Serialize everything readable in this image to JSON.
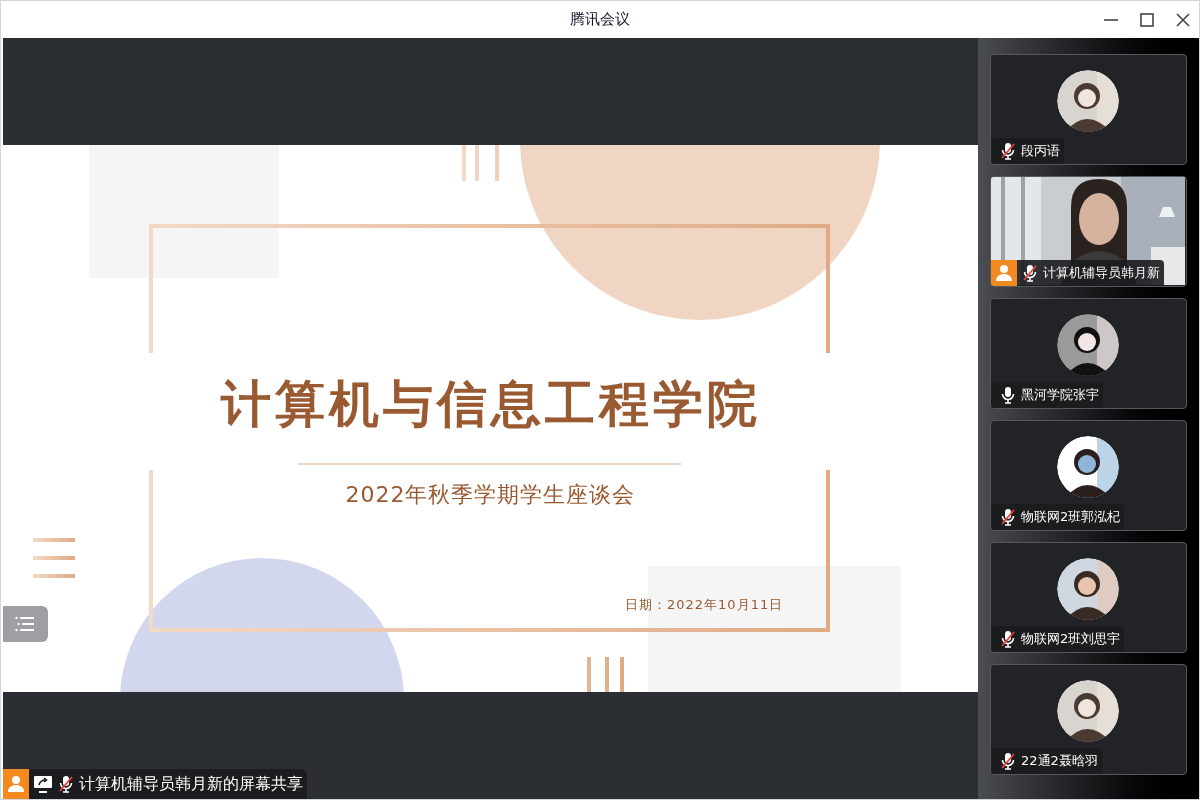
{
  "window": {
    "title": "腾讯会议"
  },
  "slide": {
    "title": "计算机与信息工程学院",
    "subtitle": "2022年秋季学期学生座谈会",
    "date": "日期：2022年10月11日"
  },
  "share_bar": {
    "host": true,
    "muted": true,
    "label": "计算机辅导员韩月新的屏幕共享"
  },
  "participants": [
    {
      "name": "段丙语",
      "kind": "avatar",
      "muted": true,
      "host": false
    },
    {
      "name": "计算机辅导员韩月新",
      "kind": "video",
      "muted": true,
      "host": true
    },
    {
      "name": "黑河学院张宇",
      "kind": "avatar",
      "muted": false,
      "host": false
    },
    {
      "name": "物联网2班郭泓杞",
      "kind": "avatar",
      "muted": true,
      "host": false
    },
    {
      "name": "物联网2班刘思宇",
      "kind": "avatar",
      "muted": true,
      "host": false
    },
    {
      "name": "22通2聂晗羽",
      "kind": "avatar",
      "muted": true,
      "host": false
    }
  ]
}
